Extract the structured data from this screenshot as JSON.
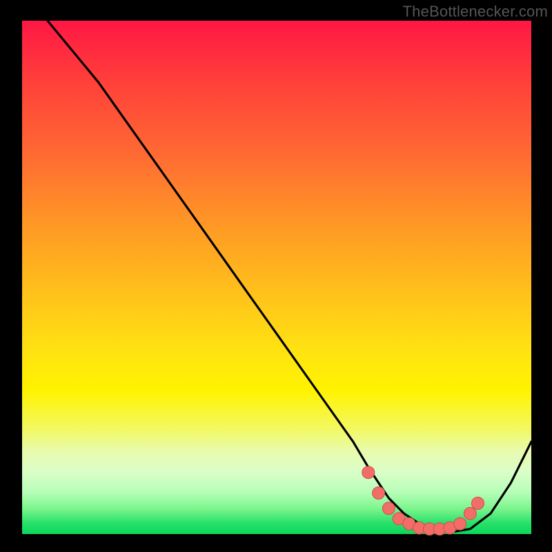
{
  "watermark": "TheBottlenecker.com",
  "colors": {
    "bg": "#000000",
    "curve": "#000000",
    "marker_fill": "#f36d68",
    "marker_stroke": "#c94f4a"
  },
  "chart_data": {
    "type": "line",
    "title": "",
    "xlabel": "",
    "ylabel": "",
    "xlim": [
      0,
      100
    ],
    "ylim": [
      0,
      100
    ],
    "grid": false,
    "legend": false,
    "annotations": [
      "TheBottlenecker.com"
    ],
    "series": [
      {
        "name": "bottleneck-curve",
        "x": [
          5,
          10,
          15,
          20,
          25,
          30,
          35,
          40,
          45,
          50,
          55,
          60,
          65,
          68,
          70,
          72,
          75,
          78,
          80,
          82,
          85,
          88,
          92,
          96,
          100
        ],
        "y": [
          100,
          94,
          88,
          81,
          74,
          67,
          60,
          53,
          46,
          39,
          32,
          25,
          18,
          13,
          10,
          7,
          4,
          2,
          1,
          0.5,
          0.5,
          1,
          4,
          10,
          18
        ]
      }
    ],
    "markers": {
      "coords": [
        [
          68,
          12
        ],
        [
          70,
          8
        ],
        [
          72,
          5
        ],
        [
          74,
          3
        ],
        [
          76,
          2
        ],
        [
          78,
          1.2
        ],
        [
          80,
          1
        ],
        [
          82,
          1
        ],
        [
          84,
          1.2
        ],
        [
          86,
          2
        ],
        [
          88,
          4
        ],
        [
          89.5,
          6
        ]
      ],
      "radius_px": 9
    }
  }
}
